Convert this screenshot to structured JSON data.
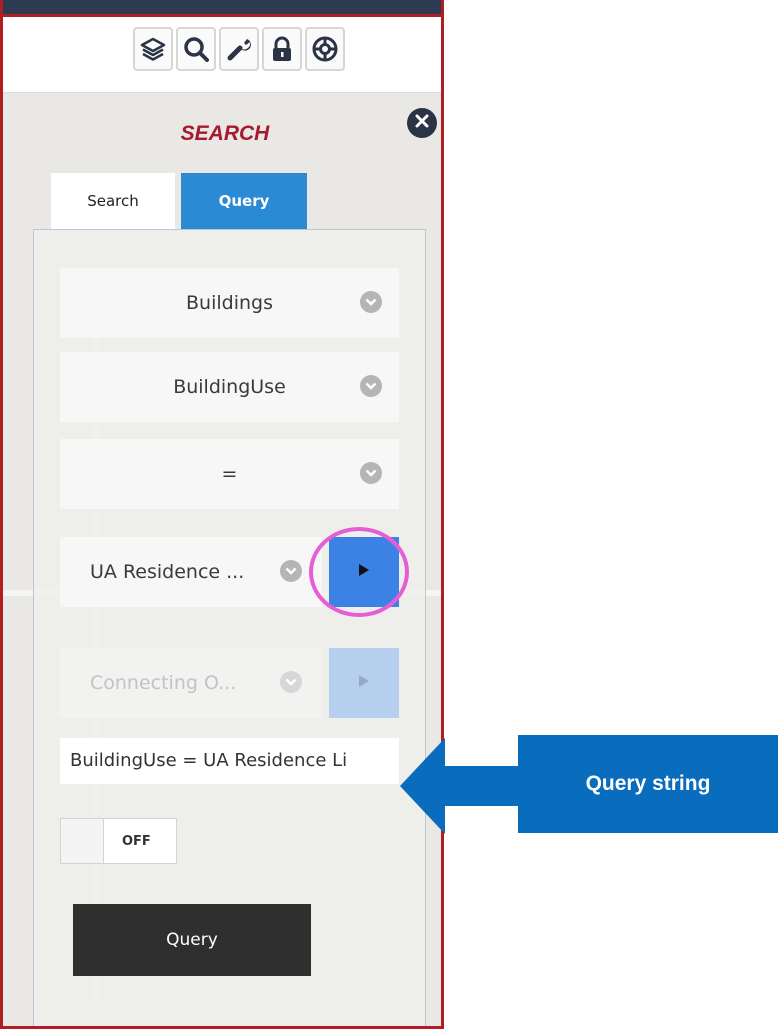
{
  "panel": {
    "title": "SEARCH",
    "accent_color": "#a6192e",
    "border_color": "#b01e23"
  },
  "toolbar": {
    "items": [
      {
        "icon": "layers-icon"
      },
      {
        "icon": "search-icon"
      },
      {
        "icon": "wrench-icon"
      },
      {
        "icon": "lock-icon"
      },
      {
        "icon": "lifebuoy-icon"
      }
    ]
  },
  "tabs": [
    {
      "label": "Search",
      "active": false
    },
    {
      "label": "Query",
      "active": true,
      "color": "#2a8ad4"
    }
  ],
  "query_form": {
    "layer_select": "Buildings",
    "field_select": "BuildingUse",
    "operator_select": "=",
    "value_select": "UA Residence ...",
    "connector_select": "Connecting O...",
    "query_string": "BuildingUse = UA Residence Li",
    "toggle_label": "OFF",
    "submit_label": "Query"
  },
  "callout": {
    "label": "Query string",
    "color": "#0a6cbd"
  },
  "highlight_color": "#e65ed6"
}
